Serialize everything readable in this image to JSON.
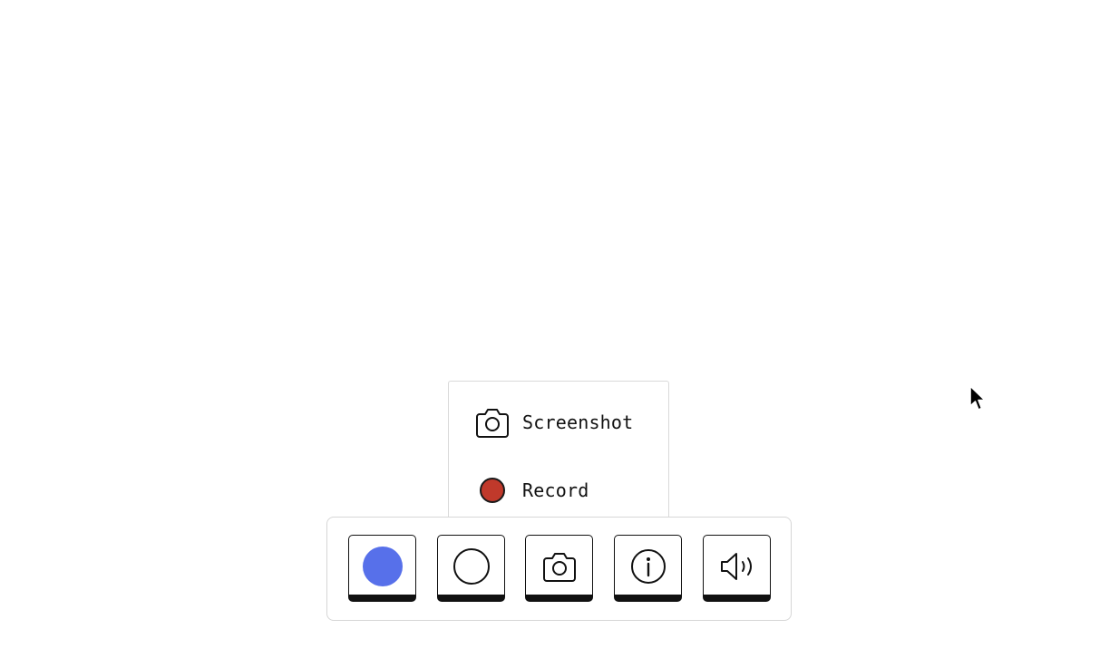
{
  "popup_menu": {
    "items": [
      {
        "label": "Screenshot",
        "icon": "camera-icon"
      },
      {
        "label": "Record",
        "icon": "record-icon",
        "color": "#c0392b"
      }
    ]
  },
  "toolbar": {
    "buttons": [
      {
        "name": "color-picker",
        "icon": "color-swatch-icon",
        "color": "#5770ea"
      },
      {
        "name": "circle-tool",
        "icon": "circle-icon"
      },
      {
        "name": "capture",
        "icon": "camera-icon"
      },
      {
        "name": "info",
        "icon": "info-icon"
      },
      {
        "name": "sound",
        "icon": "speaker-icon"
      }
    ]
  },
  "colors": {
    "accent": "#5770ea",
    "record": "#c0392b",
    "border": "#111111"
  }
}
